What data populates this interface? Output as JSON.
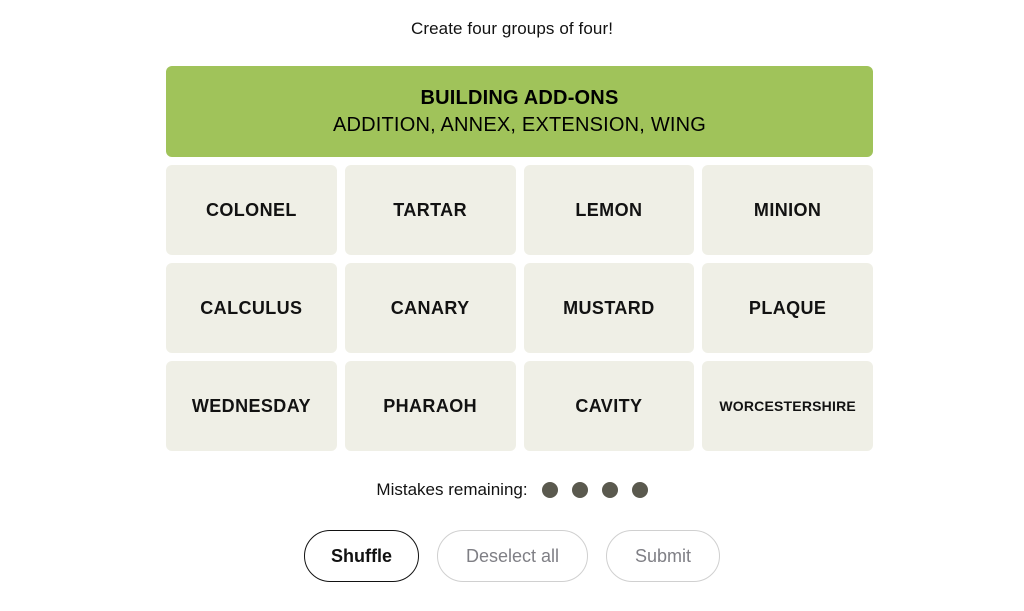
{
  "instruction": "Create four groups of four!",
  "solved_groups": [
    {
      "title": "BUILDING ADD-ONS",
      "members": "ADDITION, ANNEX, EXTENSION, WING",
      "color": "#a0c35a"
    }
  ],
  "grid": {
    "rows": [
      [
        {
          "word": "COLONEL",
          "size": "normal"
        },
        {
          "word": "TARTAR",
          "size": "normal"
        },
        {
          "word": "LEMON",
          "size": "normal"
        },
        {
          "word": "MINION",
          "size": "normal"
        }
      ],
      [
        {
          "word": "CALCULUS",
          "size": "normal"
        },
        {
          "word": "CANARY",
          "size": "normal"
        },
        {
          "word": "MUSTARD",
          "size": "normal"
        },
        {
          "word": "PLAQUE",
          "size": "normal"
        }
      ],
      [
        {
          "word": "WEDNESDAY",
          "size": "normal"
        },
        {
          "word": "PHARAOH",
          "size": "normal"
        },
        {
          "word": "CAVITY",
          "size": "normal"
        },
        {
          "word": "WORCESTERSHIRE",
          "size": "small"
        }
      ]
    ],
    "tile_color": "#efefe6",
    "tile_text_color": "#121212"
  },
  "mistakes": {
    "label": "Mistakes remaining:",
    "remaining": 4,
    "dot_color": "#5a594e"
  },
  "buttons": [
    {
      "label": "Shuffle",
      "state": "enabled"
    },
    {
      "label": "Deselect all",
      "state": "disabled"
    },
    {
      "label": "Submit",
      "state": "disabled"
    }
  ]
}
